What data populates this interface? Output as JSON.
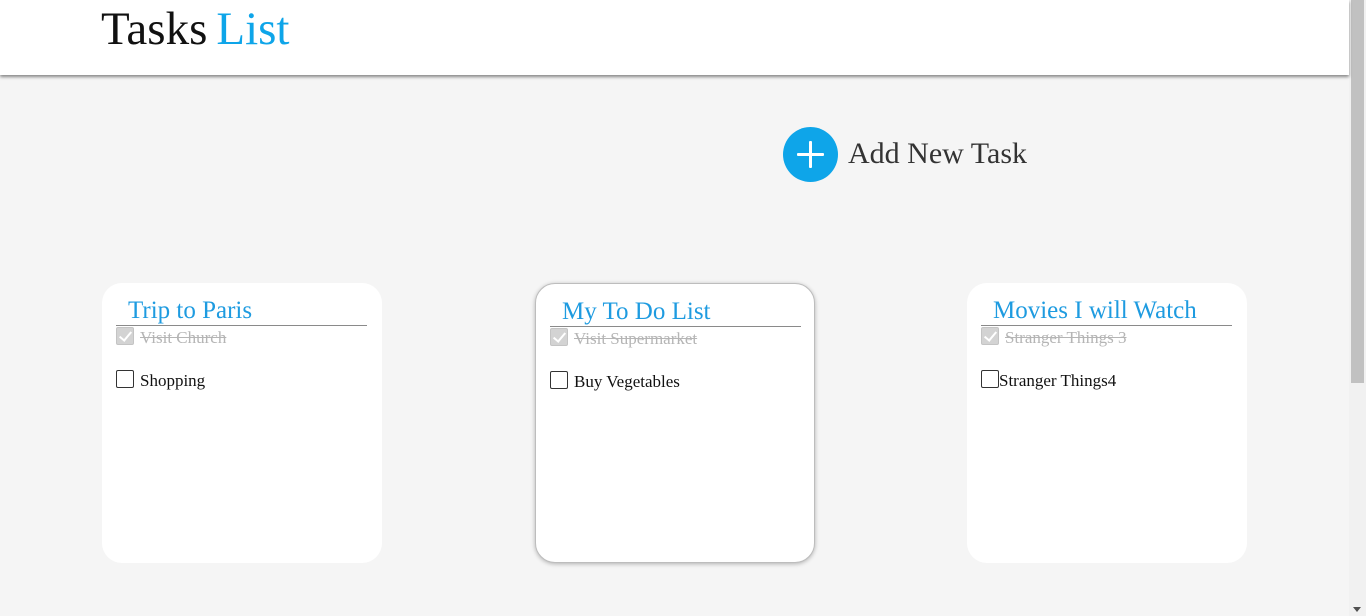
{
  "header": {
    "title_part1": "Tasks",
    "title_part2": "List"
  },
  "add_task": {
    "icon": "plus-icon",
    "label": "Add New Task"
  },
  "colors": {
    "accent": "#0ea5e9",
    "card_title": "#1e9be0",
    "background": "#f5f5f5",
    "done_text": "#b5b5b5"
  },
  "lists": [
    {
      "title": "Trip to Paris",
      "tasks": [
        {
          "label": "Visit Church",
          "done": true
        },
        {
          "label": "Shopping",
          "done": false
        }
      ]
    },
    {
      "title": "My To Do List",
      "tasks": [
        {
          "label": "Visit Supermarket",
          "done": true
        },
        {
          "label": "Buy Vegetables",
          "done": false
        }
      ]
    },
    {
      "title": "Movies I will Watch",
      "tasks": [
        {
          "label": "Stranger Things 3",
          "done": true
        },
        {
          "label": "Stranger Things4",
          "done": false
        }
      ]
    }
  ]
}
